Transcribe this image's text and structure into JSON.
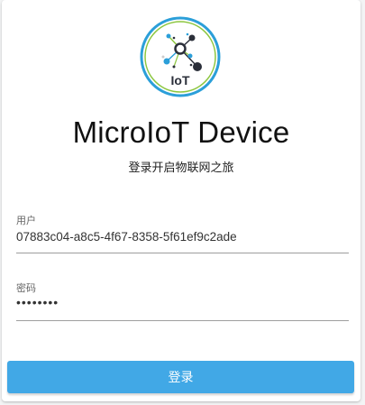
{
  "app": {
    "logo_icon": "iot-network-logo-icon",
    "logo_text": "IoT",
    "title": "MicroIoT Device",
    "subtitle": "登录开启物联网之旅"
  },
  "form": {
    "username": {
      "label": "用户",
      "value": "07883c04-a8c5-4f67-8358-5f61ef9c2ade"
    },
    "password": {
      "label": "密码",
      "value": "12345678"
    },
    "submit_label": "登录"
  },
  "colors": {
    "accent": "#41a8e6",
    "logo_ring": "#2b9fd9",
    "logo_ring_inner": "#8cc63f",
    "logo_dark": "#2b2f3a"
  }
}
